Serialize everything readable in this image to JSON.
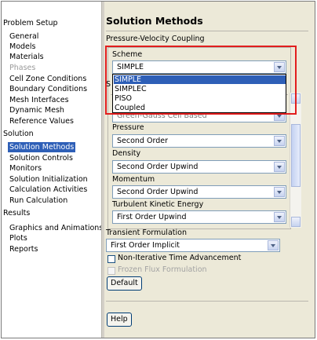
{
  "nav": {
    "groups": [
      {
        "label": "Problem Setup",
        "items": [
          {
            "label": "General",
            "state": "normal"
          },
          {
            "label": "Models",
            "state": "normal"
          },
          {
            "label": "Materials",
            "state": "normal"
          },
          {
            "label": "Phases",
            "state": "disabled"
          },
          {
            "label": "Cell Zone Conditions",
            "state": "normal"
          },
          {
            "label": "Boundary Conditions",
            "state": "normal"
          },
          {
            "label": "Mesh Interfaces",
            "state": "normal"
          },
          {
            "label": "Dynamic Mesh",
            "state": "normal"
          },
          {
            "label": "Reference Values",
            "state": "normal"
          }
        ]
      },
      {
        "label": "Solution",
        "items": [
          {
            "label": "Solution Methods",
            "state": "selected"
          },
          {
            "label": "Solution Controls",
            "state": "normal"
          },
          {
            "label": "Monitors",
            "state": "normal"
          },
          {
            "label": "Solution Initialization",
            "state": "normal"
          },
          {
            "label": "Calculation Activities",
            "state": "normal"
          },
          {
            "label": "Run Calculation",
            "state": "normal"
          }
        ]
      },
      {
        "label": "Results",
        "items": [
          {
            "label": "Graphics and Animations",
            "state": "normal"
          },
          {
            "label": "Plots",
            "state": "normal"
          },
          {
            "label": "Reports",
            "state": "normal"
          }
        ]
      }
    ]
  },
  "panel": {
    "title": "Solution Methods",
    "pv_coupling": "Pressure-Velocity Coupling",
    "scheme_label": "Scheme",
    "scheme_value": "SIMPLE",
    "scheme_options": [
      "SIMPLE",
      "SIMPLEC",
      "PISO",
      "Coupled"
    ],
    "spatial_fragment": "S",
    "gradient_value": "Green-Gauss Cell Based",
    "pressure_label": "Pressure",
    "pressure_value": "Second Order",
    "density_label": "Density",
    "density_value": "Second Order Upwind",
    "momentum_label": "Momentum",
    "momentum_value": "Second Order Upwind",
    "tke_label": "Turbulent Kinetic Energy",
    "tke_value": "First Order Upwind",
    "transient_label": "Transient Formulation",
    "transient_value": "First Order Implicit",
    "non_iterative_label": "Non-Iterative Time Advancement",
    "frozen_flux_label": "Frozen Flux Formulation",
    "default_button": "Default",
    "help_button": "Help"
  },
  "colors": {
    "selection": "#2e5fb7",
    "highlight_box": "#e21e1e",
    "panel_bg": "#ece9d8"
  }
}
